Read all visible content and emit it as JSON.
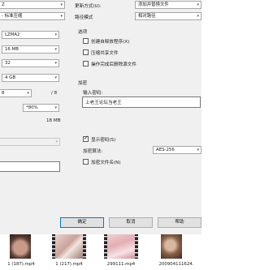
{
  "left": {
    "format_partial": "Z",
    "level": "- 标准压缩",
    "method": "LZMA2",
    "dict_size": "16 MB",
    "word_size": "32",
    "solid_block": "4 GB",
    "threads": "8",
    "threads_max": "/ 8",
    "memory": "*80%",
    "memory_total": "18 MB"
  },
  "right": {
    "update_label": "更新方式(U):",
    "update_value": "添加并替换文件",
    "path_label": "路径模式",
    "path_value": "相对路径",
    "options_title": "选项",
    "opt_sfx": "创建自释放程序(X)",
    "opt_shared": "压缩共享文件",
    "opt_delete": "操作完成后删除源文件",
    "encrypt_title": "加密",
    "password_label": "输入密码:",
    "password_value": "上老王论坛当老王",
    "show_password": "显示密码(S)",
    "enc_method_label": "加密算法:",
    "enc_method_value": "AES-256",
    "enc_names": "加密文件名(N)"
  },
  "buttons": {
    "ok": "确定",
    "cancel": "取消",
    "help": "帮助"
  },
  "files": [
    {
      "name": "1 (187).mp4"
    },
    {
      "name": "1 (217).mp4"
    },
    {
      "name": "299111.mp4"
    },
    {
      "name": "200904111624."
    }
  ],
  "colors": {
    "dialog_bg": "#f0f0f0",
    "accent": "#0078d7"
  }
}
